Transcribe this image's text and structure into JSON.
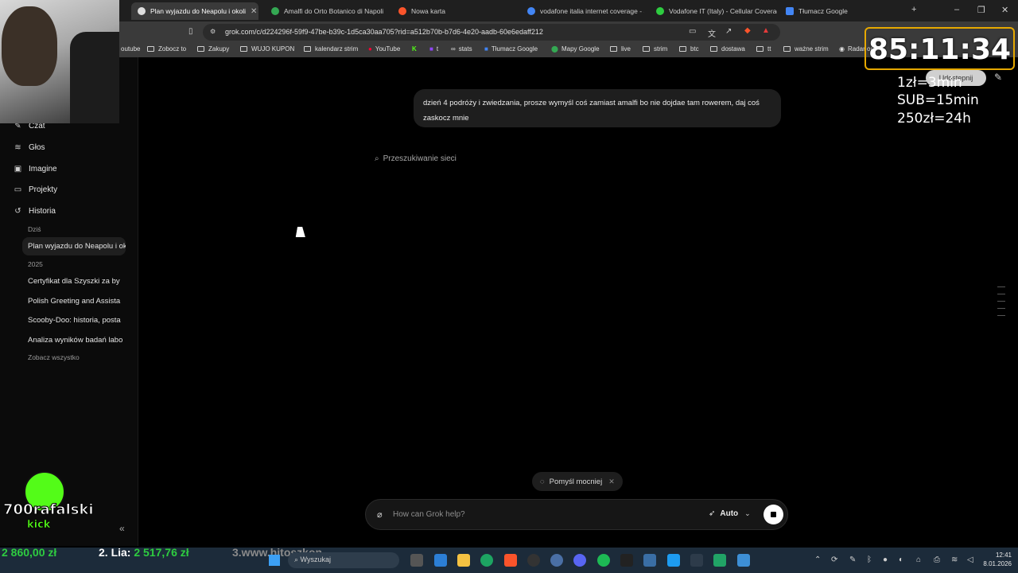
{
  "browser": {
    "tabs": [
      {
        "label": "Plan wyjazdu do Neapolu i okoli",
        "active": true
      },
      {
        "label": "Amalfi do Orto Botanico di Napoli -"
      },
      {
        "label": "Nowa karta"
      },
      {
        "label": "vodafone italia internet coverage - S"
      },
      {
        "label": "Vodafone IT (Italy) - Cellular Coverag"
      },
      {
        "label": "Tłumacz Google"
      }
    ],
    "url": "grok.com/c/d224296f-59f9-47be-b39c-1d5ca30aa705?rid=a512b70b-b7d6-4e20-aadb-60e6edaff212",
    "bookmarks": [
      "outube",
      "Zobocz to",
      "Zakupy",
      "WUJO KUPON",
      "kalendarz strim",
      "YouTube",
      "t",
      "stats",
      "Tłumacz Google",
      "Mapy Google",
      "live",
      "strim",
      "btc",
      "dostawa",
      "tt",
      "ważne strim",
      "Radar ope"
    ]
  },
  "sidebar": {
    "nav": [
      {
        "label": "Czat",
        "icon": "edit-icon"
      },
      {
        "label": "Głos",
        "icon": "voice-icon"
      },
      {
        "label": "Imagine",
        "icon": "image-icon"
      },
      {
        "label": "Projekty",
        "icon": "folder-icon"
      },
      {
        "label": "Historia",
        "icon": "history-icon"
      }
    ],
    "today_label": "Dziś",
    "year_label": "2025",
    "history_today": [
      "Plan wyjazdu do Neapolu i ok"
    ],
    "history_2025": [
      "Certyfikat dla Szyszki za by",
      "Polish Greeting and Assista",
      "Scooby-Doo: historia, posta",
      "Analiza wyników badań labo"
    ],
    "see_all": "Zobacz wszystko"
  },
  "chat": {
    "user_message": "dzień 4 podróży i zwiedzania, prosze wymyśl coś zamiast amalfi bo nie dojdae tam rowerem, daj coś zaskocz mnie",
    "status": "Przeszukiwanie sieci",
    "think_chip": "Pomyśl mocniej",
    "input_placeholder": "How can Grok help?",
    "mode": "Auto",
    "share_label": "Udostępnij"
  },
  "overlay": {
    "timer": "85:11:34",
    "rates": [
      "1zł=3min",
      "SUB=15min",
      "250zł=24h"
    ],
    "kick_name": "700rafalski",
    "kick_label": "kick",
    "ticker": {
      "t1": "2 860,00 zł",
      "t2_prefix": "2. Lia:",
      "t2_value": "2 517,76 zł",
      "t3": "3.www.hitoszkon"
    }
  },
  "taskbar": {
    "search": "Wyszukaj",
    "time": "12:41",
    "date": "8.01.2026"
  }
}
